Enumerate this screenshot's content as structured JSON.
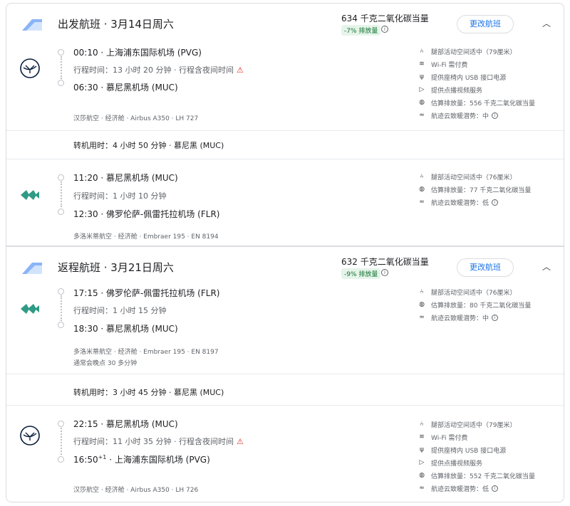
{
  "outbound": {
    "title": "出发航班 · 3月14日周六",
    "co2_total": "634 千克二氧化碳当量",
    "co2_badge": "-7% 排放量",
    "change_label": "更改航班",
    "segments": [
      {
        "dep": "00:10 · 上海浦东国际机场 (PVG)",
        "duration": "行程时间：13 小时 20 分钟 · 行程含夜间时间",
        "arr": "06:30 · 慕尼黑机场 (MUC)",
        "meta": "汉莎航空 · 经济舱 · Airbus A350 · LH 727",
        "amenities": [
          {
            "icon": "seat-icon",
            "label": "腿部活动空间适中（79厘米）"
          },
          {
            "icon": "wifi-icon",
            "label": "Wi-Fi 需付费"
          },
          {
            "icon": "usb-icon",
            "label": "提供座椅内 USB 接口电源"
          },
          {
            "icon": "video-icon",
            "label": "提供点播视频服务"
          },
          {
            "icon": "globe-icon",
            "label": "估算排放量：556 千克二氧化碳当量"
          },
          {
            "icon": "contrail-icon",
            "label": "航迹云致暖潜势：中"
          }
        ]
      },
      {
        "dep": "11:20 · 慕尼黑机场 (MUC)",
        "duration": "行程时间：1 小时 10 分钟",
        "arr": "12:30 · 佛罗伦萨-佩雷托拉机场 (FLR)",
        "meta": "多洛米蒂航空 · 经济舱 · Embraer 195 · EN 8194",
        "amenities": [
          {
            "icon": "seat-icon",
            "label": "腿部活动空间适中（76厘米）"
          },
          {
            "icon": "globe-icon",
            "label": "估算排放量：77 千克二氧化碳当量"
          },
          {
            "icon": "contrail-icon",
            "label": "航迹云致暖潜势：低"
          }
        ]
      }
    ],
    "layover": "转机用时：4 小时 50 分钟 · 慕尼黑 (MUC)"
  },
  "return": {
    "title": "返程航班 · 3月21日周六",
    "co2_total": "632 千克二氧化碳当量",
    "co2_badge": "-9% 排放量",
    "change_label": "更改航班",
    "segments": [
      {
        "dep": "17:15 · 佛罗伦萨-佩雷托拉机场 (FLR)",
        "duration": "行程时间：1 小时 15 分钟",
        "arr": "18:30 · 慕尼黑机场 (MUC)",
        "meta": "多洛米蒂航空 · 经济舱 · Embraer 195 · EN 8197",
        "delay": "通常会晚点 30 多分钟",
        "amenities": [
          {
            "icon": "seat-icon",
            "label": "腿部活动空间适中（76厘米）"
          },
          {
            "icon": "globe-icon",
            "label": "估算排放量：80 千克二氧化碳当量"
          },
          {
            "icon": "contrail-icon",
            "label": "航迹云致暖潜势：中"
          }
        ]
      },
      {
        "dep_time": "16:50",
        "dep": "22:15 · 慕尼黑机场 (MUC)",
        "duration": "行程时间：11 小时 35 分钟 · 行程含夜间时间",
        "arr_sup": "+1",
        "arr_rest": " · 上海浦东国际机场 (PVG)",
        "meta": "汉莎航空 · 经济舱 · Airbus A350 · LH 726",
        "amenities": [
          {
            "icon": "seat-icon",
            "label": "腿部活动空间适中（79厘米）"
          },
          {
            "icon": "wifi-icon",
            "label": "Wi-Fi 需付费"
          },
          {
            "icon": "usb-icon",
            "label": "提供座椅内 USB 接口电源"
          },
          {
            "icon": "video-icon",
            "label": "提供点播视频服务"
          },
          {
            "icon": "globe-icon",
            "label": "估算排放量：552 千克二氧化碳当量"
          },
          {
            "icon": "contrail-icon",
            "label": "航迹云致暖潜势：低"
          }
        ]
      }
    ],
    "layover": "转机用时：3 小时 45 分钟 · 慕尼黑 (MUC)"
  },
  "colors": {
    "accent": "#1a73e8",
    "badge_bg": "#e6f4ea",
    "badge_text": "#137333",
    "warning": "#d93025"
  }
}
